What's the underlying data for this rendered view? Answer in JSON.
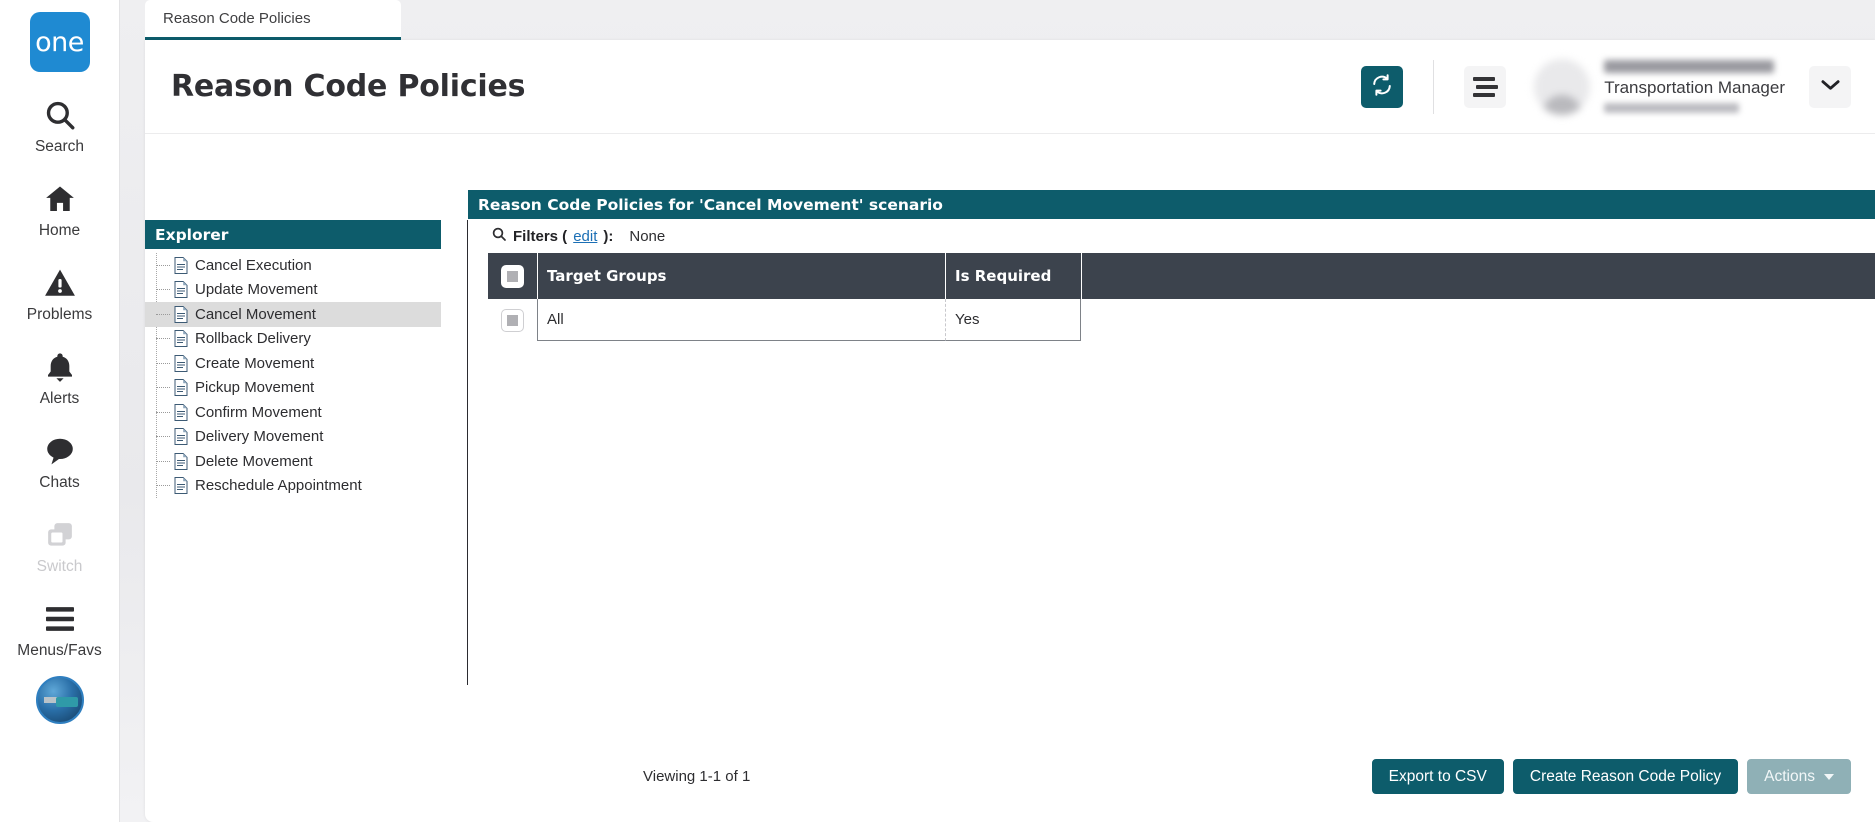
{
  "brand": {
    "logo_text": "one"
  },
  "rail": {
    "items": [
      {
        "label": "Search",
        "icon": "search-icon",
        "disabled": false
      },
      {
        "label": "Home",
        "icon": "home-icon",
        "disabled": false
      },
      {
        "label": "Problems",
        "icon": "warning-icon",
        "disabled": false
      },
      {
        "label": "Alerts",
        "icon": "bell-icon",
        "disabled": false
      },
      {
        "label": "Chats",
        "icon": "chat-icon",
        "disabled": false
      },
      {
        "label": "Switch",
        "icon": "switch-icon",
        "disabled": true
      },
      {
        "label": "Menus/Favs",
        "icon": "hamburger-icon",
        "disabled": false
      }
    ],
    "assistant_avatar": "robot-avatar"
  },
  "tabs": [
    {
      "label": "Reason Code Policies",
      "active": true
    }
  ],
  "header": {
    "title": "Reason Code Policies",
    "refresh_icon": "refresh-icon",
    "menu_icon": "menu-icon",
    "caret_icon": "chevron-down-icon",
    "user": {
      "name": "",
      "role": "Transportation Manager",
      "email": ""
    }
  },
  "explorer": {
    "title": "Explorer",
    "items": [
      {
        "label": "Cancel Execution",
        "selected": false
      },
      {
        "label": "Update Movement",
        "selected": false
      },
      {
        "label": "Cancel Movement",
        "selected": true
      },
      {
        "label": "Rollback Delivery",
        "selected": false
      },
      {
        "label": "Create Movement",
        "selected": false
      },
      {
        "label": "Pickup Movement",
        "selected": false
      },
      {
        "label": "Confirm Movement",
        "selected": false
      },
      {
        "label": "Delivery Movement",
        "selected": false
      },
      {
        "label": "Delete Movement",
        "selected": false
      },
      {
        "label": "Reschedule Appointment",
        "selected": false
      }
    ]
  },
  "content": {
    "title": "Reason Code Policies for 'Cancel Movement' scenario",
    "filters": {
      "icon": "search-icon",
      "label": "Filters (",
      "edit_link": "edit",
      "label_close": "):",
      "value": "None"
    },
    "table": {
      "columns": [
        "Target Groups",
        "Is Required"
      ],
      "rows": [
        {
          "target_groups": "All",
          "is_required": "Yes"
        }
      ]
    },
    "viewing": "Viewing 1-1 of 1",
    "buttons": {
      "export": "Export to CSV",
      "create": "Create Reason Code Policy",
      "actions": "Actions"
    }
  },
  "colors": {
    "teal": "#0d5c6b",
    "brand_blue": "#1f8ad2",
    "grid_header": "#3c434d",
    "link": "#1b6fb5",
    "muted_button": "#8fb0b6"
  }
}
